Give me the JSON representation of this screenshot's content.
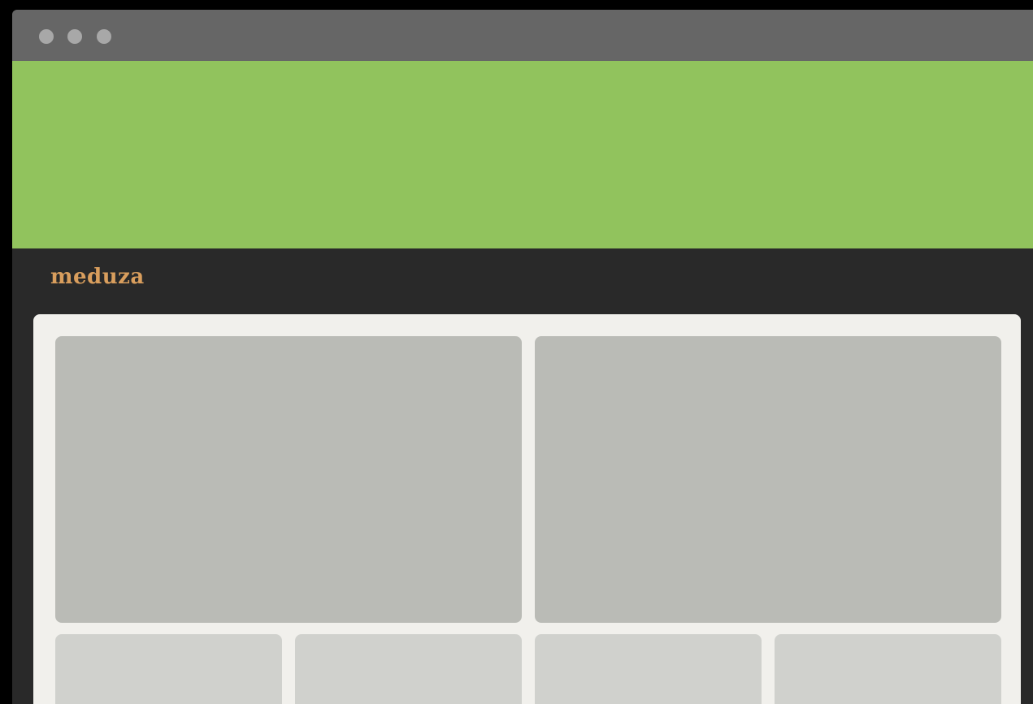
{
  "colors": {
    "titlebar": "#666666",
    "traffic_light": "#a8a8a8",
    "banner": "#91c35d",
    "header_background": "#292929",
    "logo": "#d99e5d",
    "content_background": "#f1f0ec",
    "large_placeholder": "#babbb6",
    "small_placeholder": "#d0d1cd"
  },
  "header": {
    "logo_text": "meduza"
  }
}
